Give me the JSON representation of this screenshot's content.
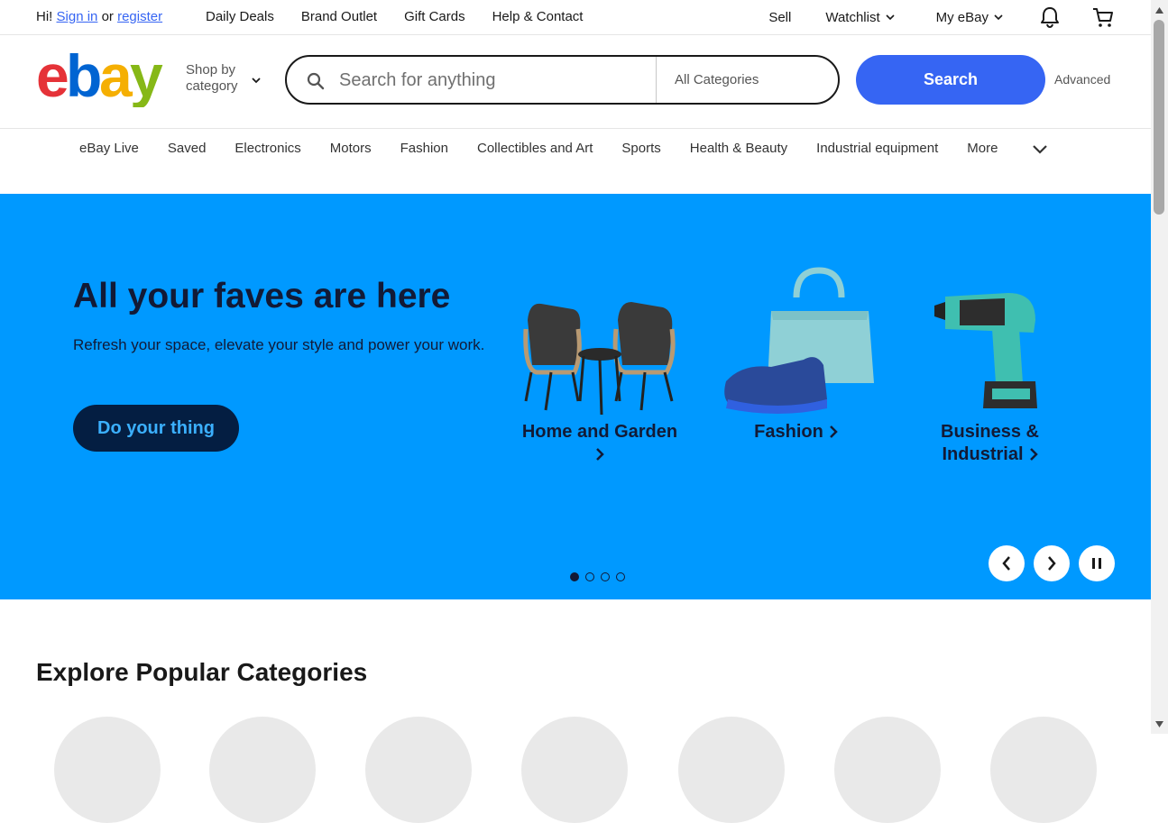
{
  "topbar": {
    "greeting_prefix": "Hi!",
    "sign_in": "Sign in",
    "or": "or",
    "register": "register",
    "links": [
      "Daily Deals",
      "Brand Outlet",
      "Gift Cards",
      "Help & Contact"
    ],
    "sell": "Sell",
    "watchlist": "Watchlist",
    "my_ebay": "My eBay"
  },
  "header": {
    "logo_letters": [
      "e",
      "b",
      "a",
      "y"
    ],
    "shop_by_line1": "Shop by",
    "shop_by_line2": "category",
    "search_placeholder": "Search for anything",
    "category_select": "All Categories",
    "search_button": "Search",
    "advanced": "Advanced"
  },
  "nav": {
    "items": [
      "eBay Live",
      "Saved",
      "Electronics",
      "Motors",
      "Fashion",
      "Collectibles and Art",
      "Sports",
      "Health & Beauty",
      "Industrial equipment"
    ],
    "more": "More"
  },
  "hero": {
    "title": "All your faves are here",
    "subtitle": "Refresh your space, elevate your style and power your work.",
    "cta": "Do your thing",
    "tiles": [
      {
        "label": "Home and Garden"
      },
      {
        "label": "Fashion"
      },
      {
        "label_line1": "Business &",
        "label_line2": "Industrial"
      }
    ],
    "carousel_slides": 4,
    "carousel_active": 1
  },
  "explore": {
    "title": "Explore Popular Categories"
  },
  "colors": {
    "brand_blue": "#3665f3",
    "hero_bg": "#0099ff",
    "hero_text": "#121a36",
    "cta_bg": "#041e42",
    "cta_text": "#3bb0ff",
    "logo_e": "#e53238",
    "logo_b": "#0064d2",
    "logo_a": "#f5af02",
    "logo_y": "#86b817"
  },
  "icons": [
    "search-icon",
    "bell-icon",
    "cart-icon",
    "chevron-down-icon",
    "chevron-right-icon",
    "chevron-left-icon",
    "pause-icon"
  ]
}
